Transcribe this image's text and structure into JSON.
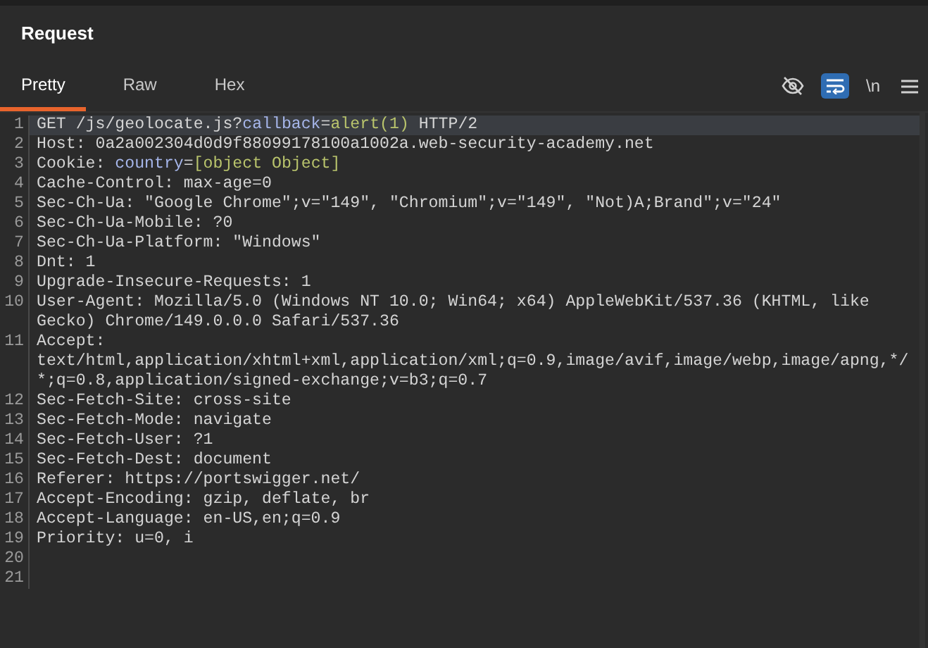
{
  "panel": {
    "title": "Request"
  },
  "tabs": [
    {
      "label": "Pretty",
      "selected": true
    },
    {
      "label": "Raw",
      "selected": false
    },
    {
      "label": "Hex",
      "selected": false
    }
  ],
  "toolbar": [
    {
      "kind": "hide",
      "on": false
    },
    {
      "kind": "wrap",
      "on": true
    },
    {
      "kind": "newline",
      "label": "\\n",
      "on": false
    },
    {
      "kind": "menu",
      "on": false
    }
  ],
  "lines": [
    {
      "number": "1",
      "current": true,
      "rows": [
        [
          {
            "kind": "plain",
            "text": "GET /js/geolocate.js?"
          },
          {
            "kind": "param",
            "text": "callback"
          },
          {
            "kind": "plain",
            "text": "="
          },
          {
            "kind": "value",
            "text": "alert(1)"
          },
          {
            "kind": "plain",
            "text": " HTTP/2"
          }
        ]
      ]
    },
    {
      "number": "2",
      "current": false,
      "rows": [
        [
          {
            "kind": "plain",
            "text": "Host: 0a2a002304d0d9f88099178100a1002a.web-security-academy.net"
          }
        ]
      ]
    },
    {
      "number": "3",
      "current": false,
      "rows": [
        [
          {
            "kind": "plain",
            "text": "Cookie: "
          },
          {
            "kind": "param",
            "text": "country"
          },
          {
            "kind": "plain",
            "text": "="
          },
          {
            "kind": "value",
            "text": "[object Object]"
          }
        ]
      ]
    },
    {
      "number": "4",
      "current": false,
      "rows": [
        [
          {
            "kind": "plain",
            "text": "Cache-Control: max-age=0"
          }
        ]
      ]
    },
    {
      "number": "5",
      "current": false,
      "rows": [
        [
          {
            "kind": "plain",
            "text": "Sec-Ch-Ua: \"Google Chrome\";v=\"149\", \"Chromium\";v=\"149\", \"Not)A;Brand\";v=\"24\""
          }
        ]
      ]
    },
    {
      "number": "6",
      "current": false,
      "rows": [
        [
          {
            "kind": "plain",
            "text": "Sec-Ch-Ua-Mobile: ?0"
          }
        ]
      ]
    },
    {
      "number": "7",
      "current": false,
      "rows": [
        [
          {
            "kind": "plain",
            "text": "Sec-Ch-Ua-Platform: \"Windows\""
          }
        ]
      ]
    },
    {
      "number": "8",
      "current": false,
      "rows": [
        [
          {
            "kind": "plain",
            "text": "Dnt: 1"
          }
        ]
      ]
    },
    {
      "number": "9",
      "current": false,
      "rows": [
        [
          {
            "kind": "plain",
            "text": "Upgrade-Insecure-Requests: 1"
          }
        ]
      ]
    },
    {
      "number": "10",
      "current": false,
      "rows": [
        [
          {
            "kind": "plain",
            "text": "User-Agent: Mozilla/5.0 (Windows NT 10.0; Win64; x64) AppleWebKit/537.36 (KHTML, like"
          }
        ],
        [
          {
            "kind": "plain",
            "text": "Gecko) Chrome/149.0.0.0 Safari/537.36"
          }
        ]
      ]
    },
    {
      "number": "11",
      "current": false,
      "rows": [
        [
          {
            "kind": "plain",
            "text": "Accept:"
          }
        ],
        [
          {
            "kind": "plain",
            "text": "text/html,application/xhtml+xml,application/xml;q=0.9,image/avif,image/webp,image/apng,*/"
          }
        ],
        [
          {
            "kind": "plain",
            "text": "*;q=0.8,application/signed-exchange;v=b3;q=0.7"
          }
        ]
      ]
    },
    {
      "number": "12",
      "current": false,
      "rows": [
        [
          {
            "kind": "plain",
            "text": "Sec-Fetch-Site: cross-site"
          }
        ]
      ]
    },
    {
      "number": "13",
      "current": false,
      "rows": [
        [
          {
            "kind": "plain",
            "text": "Sec-Fetch-Mode: navigate"
          }
        ]
      ]
    },
    {
      "number": "14",
      "current": false,
      "rows": [
        [
          {
            "kind": "plain",
            "text": "Sec-Fetch-User: ?1"
          }
        ]
      ]
    },
    {
      "number": "15",
      "current": false,
      "rows": [
        [
          {
            "kind": "plain",
            "text": "Sec-Fetch-Dest: document"
          }
        ]
      ]
    },
    {
      "number": "16",
      "current": false,
      "rows": [
        [
          {
            "kind": "plain",
            "text": "Referer: https://portswigger.net/"
          }
        ]
      ]
    },
    {
      "number": "17",
      "current": false,
      "rows": [
        [
          {
            "kind": "plain",
            "text": "Accept-Encoding: gzip, deflate, br"
          }
        ]
      ]
    },
    {
      "number": "18",
      "current": false,
      "rows": [
        [
          {
            "kind": "plain",
            "text": "Accept-Language: en-US,en;q=0.9"
          }
        ]
      ]
    },
    {
      "number": "19",
      "current": false,
      "rows": [
        [
          {
            "kind": "plain",
            "text": "Priority: u=0, i"
          }
        ]
      ]
    },
    {
      "number": "20",
      "current": false
    },
    {
      "number": "21",
      "current": false
    }
  ]
}
